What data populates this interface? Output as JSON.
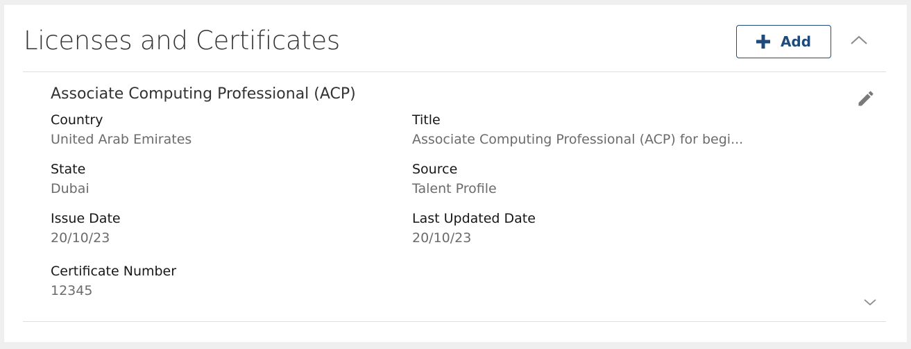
{
  "section": {
    "title": "Licenses and Certificates",
    "add_button_label": "Add",
    "collapse_icon": "chevron-up-icon"
  },
  "record": {
    "title": "Associate Computing Professional (ACP)",
    "edit_icon": "pencil-icon",
    "expand_icon": "chevron-down-icon",
    "fields": [
      {
        "label": "Country",
        "value": "United Arab Emirates"
      },
      {
        "label": "Title",
        "value": "Associate Computing Professional (ACP) for begi..."
      },
      {
        "label": "State",
        "value": "Dubai"
      },
      {
        "label": "Source",
        "value": "Talent Profile"
      },
      {
        "label": "Issue Date",
        "value": "20/10/23"
      },
      {
        "label": "Last Updated Date",
        "value": "20/10/23"
      },
      {
        "label": "Certificate Number",
        "value": "12345"
      }
    ]
  },
  "colors": {
    "accent": "#1f4a7c",
    "label_text": "#161616",
    "value_text": "#6b6b6b",
    "page_background": "#efefef"
  }
}
